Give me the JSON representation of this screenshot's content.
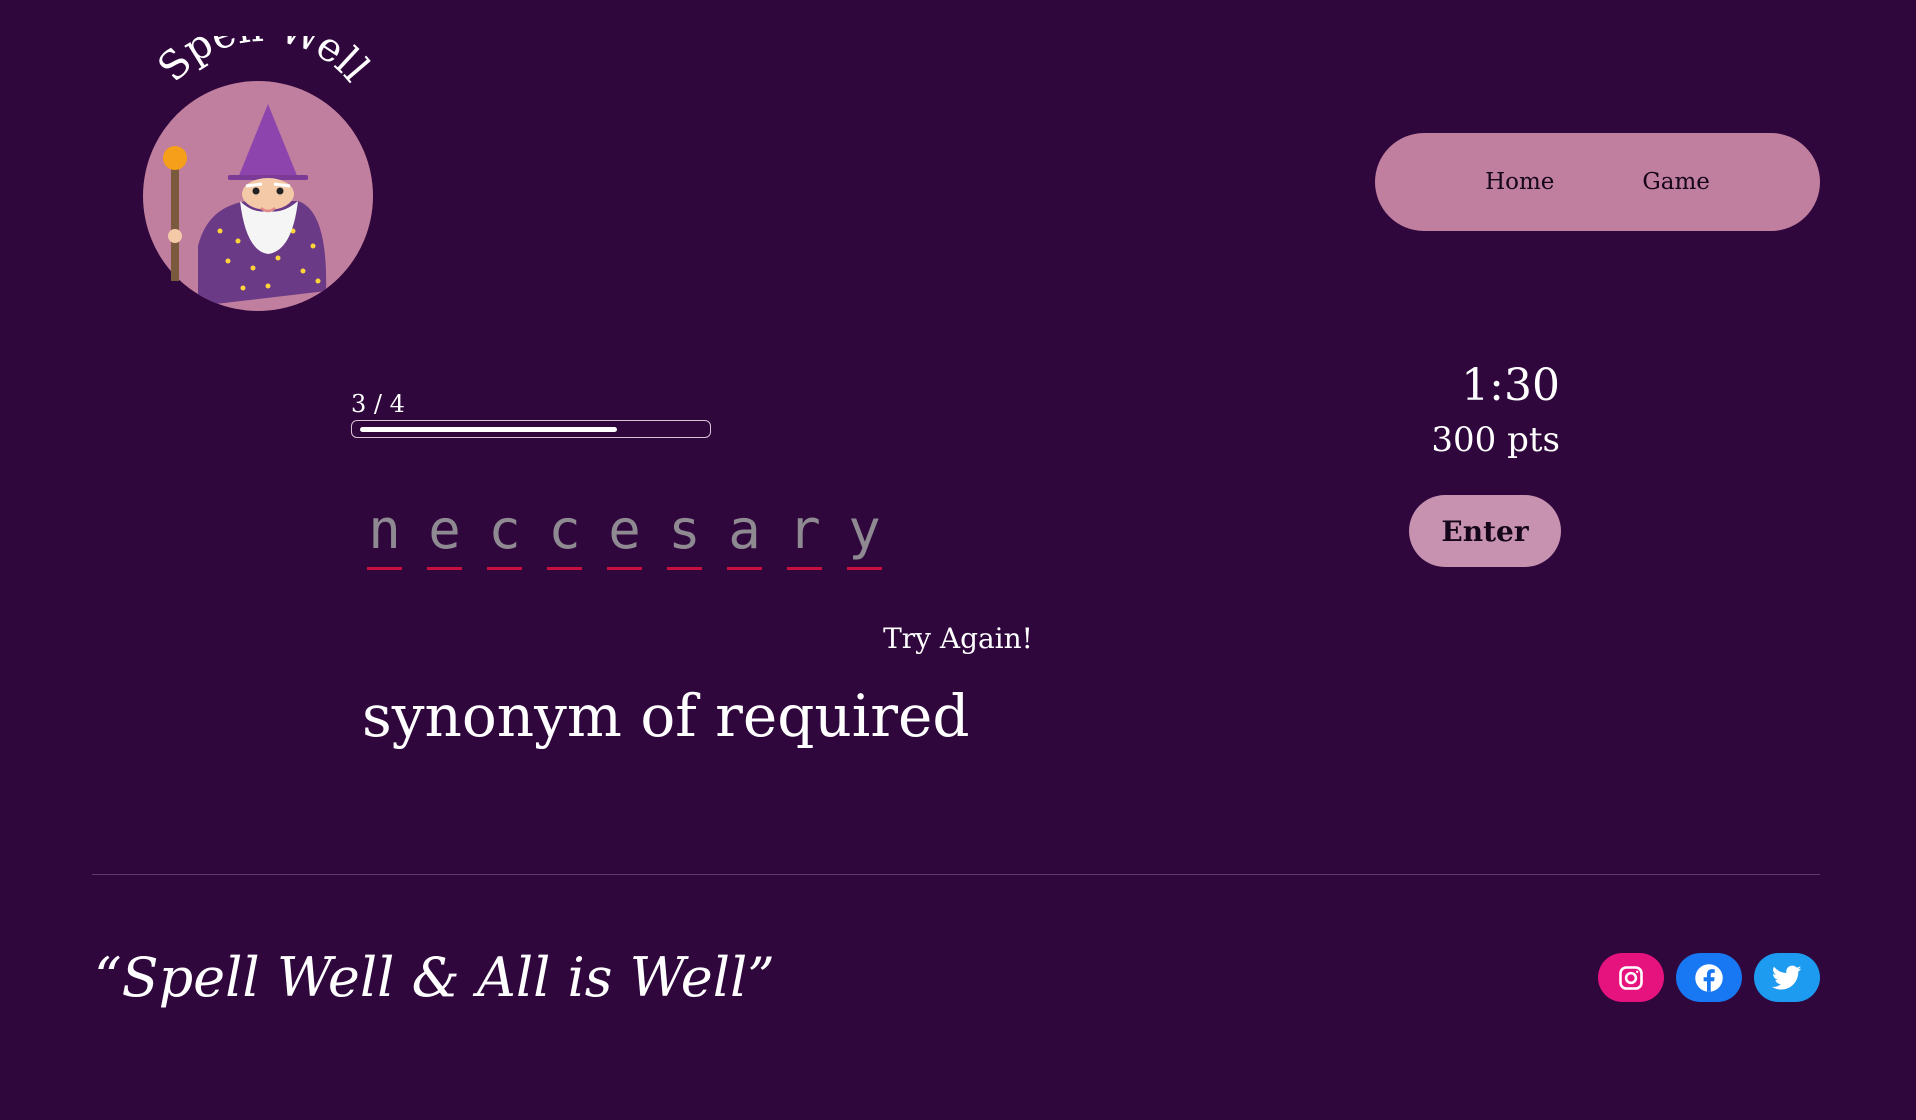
{
  "brand": {
    "name": "Spell Well"
  },
  "nav": {
    "items": [
      {
        "label": "Home"
      },
      {
        "label": "Game"
      }
    ]
  },
  "colors": {
    "background": "#2f073d",
    "nav_pill": "#c07f9e",
    "enter_button": "#c792b0",
    "letter_underline": "#c8103c",
    "instagram": "#e6137f",
    "facebook": "#1877f2",
    "twitter": "#1d9bf0"
  },
  "game": {
    "progress": {
      "current": 3,
      "total": 4,
      "label": "3 / 4",
      "fill_fraction": 0.75
    },
    "timer": "1:30",
    "score": "300 pts",
    "letters": [
      "n",
      "e",
      "c",
      "c",
      "e",
      "s",
      "a",
      "r",
      "y"
    ],
    "enter_label": "Enter",
    "feedback": "Try Again!",
    "hint": "synonym of required"
  },
  "footer": {
    "tagline": "“Spell Well & All is Well”",
    "socials": [
      {
        "name": "instagram-icon"
      },
      {
        "name": "facebook-icon"
      },
      {
        "name": "twitter-icon"
      }
    ]
  }
}
